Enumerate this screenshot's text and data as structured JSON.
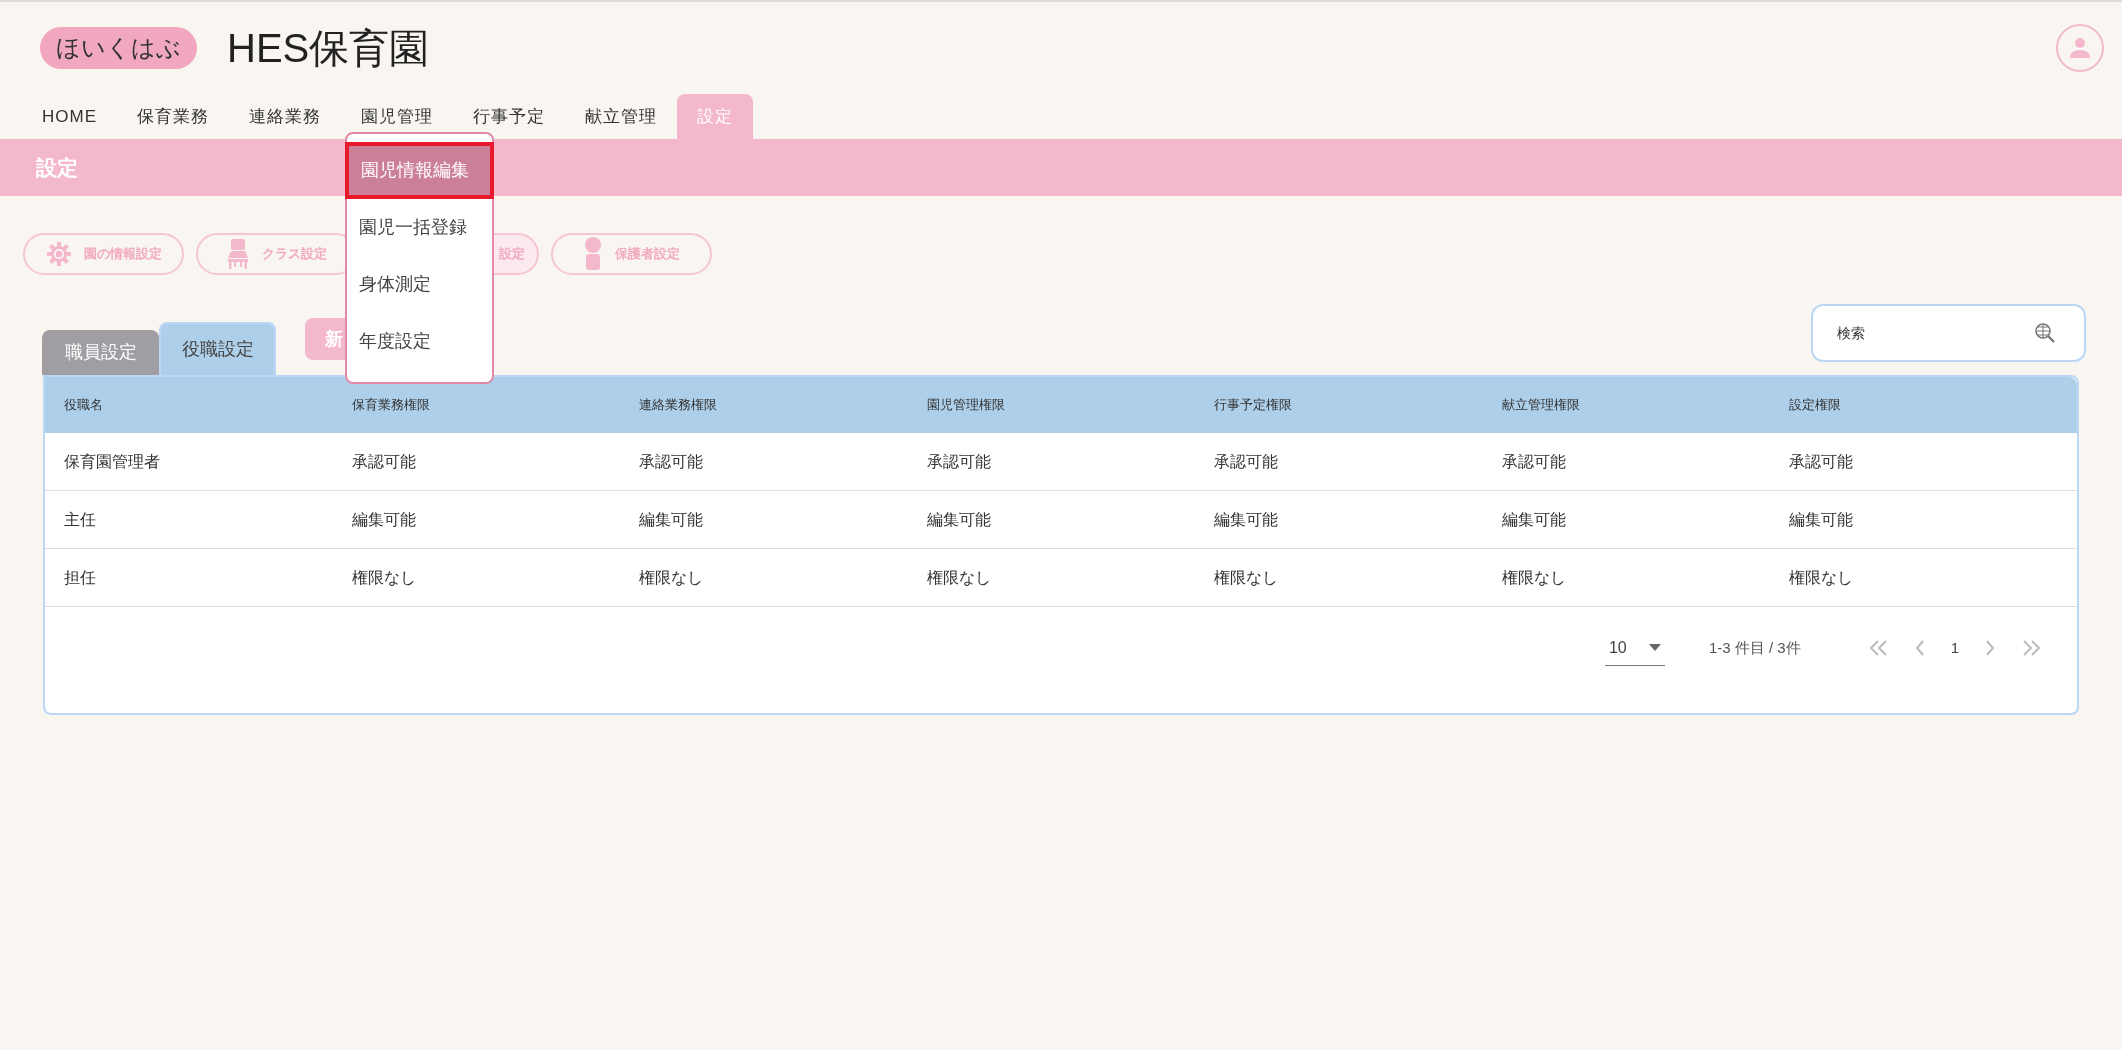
{
  "header": {
    "logo": "ほいくはぶ",
    "title": "HES保育園"
  },
  "nav": [
    {
      "label": "HOME",
      "selected": false
    },
    {
      "label": "保育業務",
      "selected": false
    },
    {
      "label": "連絡業務",
      "selected": false
    },
    {
      "label": "園児管理",
      "selected": false
    },
    {
      "label": "行事予定",
      "selected": false
    },
    {
      "label": "献立管理",
      "selected": false
    },
    {
      "label": "設定",
      "selected": true
    }
  ],
  "dropdown": [
    {
      "label": "園児情報編集",
      "selected": true
    },
    {
      "label": "園児一括登録",
      "selected": false
    },
    {
      "label": "身体測定",
      "selected": false
    },
    {
      "label": "年度設定",
      "selected": false
    }
  ],
  "page_title": "設定",
  "setting_buttons": [
    {
      "label": "園の情報設定",
      "kind": "gear"
    },
    {
      "label": "クラス設定",
      "kind": "chair"
    },
    {
      "label": "設定",
      "kind": "hidden"
    },
    {
      "label": "保護者設定",
      "kind": "person"
    }
  ],
  "tabs": [
    {
      "label": "職員設定",
      "selected": false
    },
    {
      "label": "役職設定",
      "selected": true
    }
  ],
  "new_button": "新",
  "search": {
    "placeholder": "検索"
  },
  "table": {
    "columns": [
      "役職名",
      "保育業務権限",
      "連絡業務権限",
      "園児管理権限",
      "行事予定権限",
      "献立管理権限",
      "設定権限"
    ],
    "rows": [
      [
        "保育園管理者",
        "承認可能",
        "承認可能",
        "承認可能",
        "承認可能",
        "承認可能",
        "承認可能"
      ],
      [
        "主任",
        "編集可能",
        "編集可能",
        "編集可能",
        "編集可能",
        "編集可能",
        "編集可能"
      ],
      [
        "担任",
        "権限なし",
        "権限なし",
        "権限なし",
        "権限なし",
        "権限なし",
        "権限なし"
      ]
    ]
  },
  "pagination": {
    "page_size": "10",
    "range": "1-3 件目 / 3件",
    "page": "1"
  }
}
